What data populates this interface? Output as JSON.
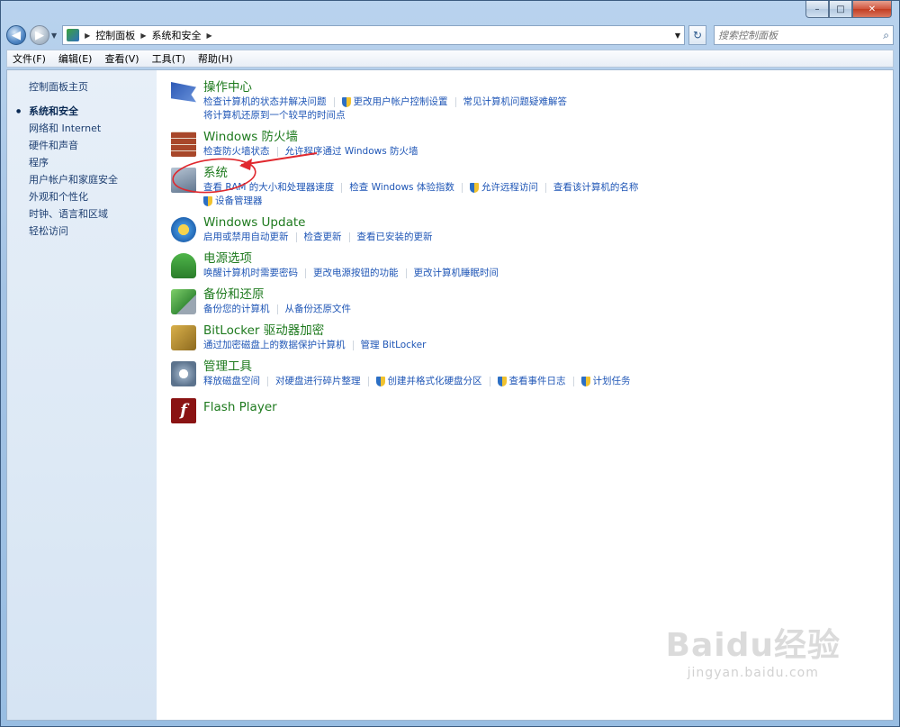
{
  "window": {
    "caption": {
      "min": "–",
      "max": "□",
      "close": "✕"
    }
  },
  "address": {
    "crumbs": [
      "控制面板",
      "系统和安全"
    ],
    "search_placeholder": "搜索控制面板"
  },
  "menu": [
    "文件(F)",
    "编辑(E)",
    "查看(V)",
    "工具(T)",
    "帮助(H)"
  ],
  "sidebar": {
    "home": "控制面板主页",
    "items": [
      {
        "label": "系统和安全",
        "current": true
      },
      {
        "label": "网络和 Internet"
      },
      {
        "label": "硬件和声音"
      },
      {
        "label": "程序"
      },
      {
        "label": "用户帐户和家庭安全"
      },
      {
        "label": "外观和个性化"
      },
      {
        "label": "时钟、语言和区域"
      },
      {
        "label": "轻松访问"
      }
    ]
  },
  "categories": [
    {
      "title": "操作中心",
      "icon": "action-center-flag-icon",
      "lines": [
        [
          {
            "text": "检查计算机的状态并解决问题"
          },
          {
            "text": "更改用户帐户控制设置",
            "shield": true
          },
          {
            "text": "常见计算机问题疑难解答"
          }
        ],
        [
          {
            "text": "将计算机还原到一个较早的时间点"
          }
        ]
      ]
    },
    {
      "title": "Windows 防火墙",
      "icon": "firewall-icon",
      "lines": [
        [
          {
            "text": "检查防火墙状态"
          },
          {
            "text": "允许程序通过 Windows 防火墙"
          }
        ]
      ]
    },
    {
      "title": "系统",
      "icon": "system-icon",
      "lines": [
        [
          {
            "text": "查看 RAM 的大小和处理器速度"
          },
          {
            "text": "检查 Windows 体验指数"
          },
          {
            "text": "允许远程访问",
            "shield": true
          },
          {
            "text": "查看该计算机的名称"
          }
        ],
        [
          {
            "text": "设备管理器",
            "shield": true
          }
        ]
      ]
    },
    {
      "title": "Windows Update",
      "icon": "windows-update-icon",
      "lines": [
        [
          {
            "text": "启用或禁用自动更新"
          },
          {
            "text": "检查更新"
          },
          {
            "text": "查看已安装的更新"
          }
        ]
      ]
    },
    {
      "title": "电源选项",
      "icon": "power-options-icon",
      "lines": [
        [
          {
            "text": "唤醒计算机时需要密码"
          },
          {
            "text": "更改电源按钮的功能"
          },
          {
            "text": "更改计算机睡眠时间"
          }
        ]
      ]
    },
    {
      "title": "备份和还原",
      "icon": "backup-restore-icon",
      "lines": [
        [
          {
            "text": "备份您的计算机"
          },
          {
            "text": "从备份还原文件"
          }
        ]
      ]
    },
    {
      "title": "BitLocker 驱动器加密",
      "icon": "bitlocker-icon",
      "lines": [
        [
          {
            "text": "通过加密磁盘上的数据保护计算机"
          },
          {
            "text": "管理 BitLocker"
          }
        ]
      ]
    },
    {
      "title": "管理工具",
      "icon": "admin-tools-icon",
      "lines": [
        [
          {
            "text": "释放磁盘空间"
          },
          {
            "text": "对硬盘进行碎片整理"
          },
          {
            "text": "创建并格式化硬盘分区",
            "shield": true
          },
          {
            "text": "查看事件日志",
            "shield": true
          },
          {
            "text": "计划任务",
            "shield": true
          }
        ]
      ]
    },
    {
      "title": "Flash Player",
      "icon": "flash-player-icon",
      "lines": []
    }
  ],
  "watermark": {
    "logo": "Baidu经验",
    "url": "jingyan.baidu.com"
  },
  "colors": {
    "link": "#1f56b6",
    "category_title": "#1e7a1e",
    "annotation": "#e0282e"
  }
}
